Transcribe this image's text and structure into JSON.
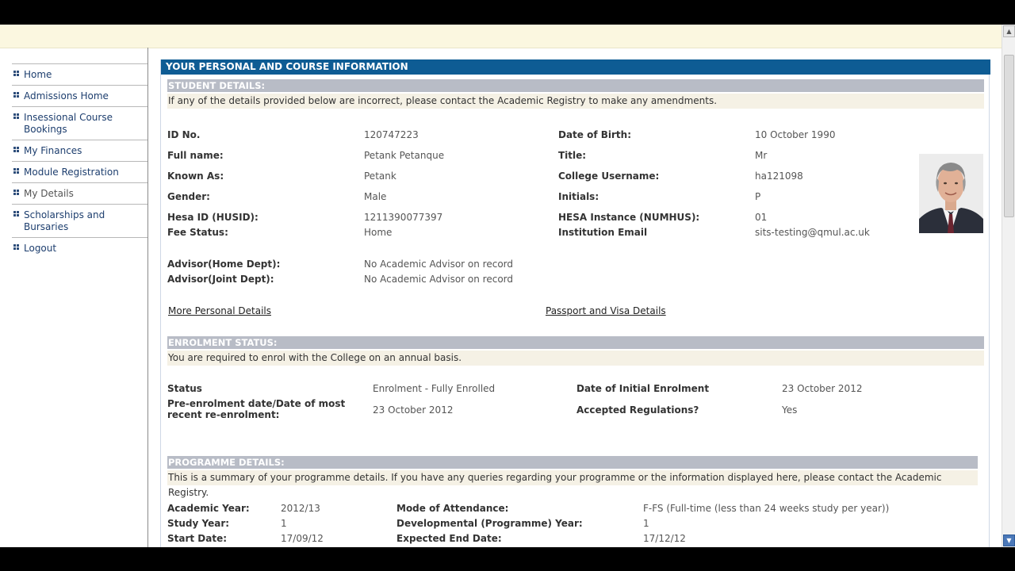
{
  "sidebar": {
    "items": [
      {
        "label": "Home"
      },
      {
        "label": "Admissions Home"
      },
      {
        "label": "Insessional Course Bookings"
      },
      {
        "label": "My Finances"
      },
      {
        "label": "Module Registration"
      },
      {
        "label": "My Details"
      },
      {
        "label": "Scholarships and Bursaries"
      },
      {
        "label": "Logout"
      }
    ]
  },
  "main": {
    "title": "YOUR PERSONAL AND COURSE INFORMATION"
  },
  "student": {
    "heading": "STUDENT DETAILS:",
    "note": "If any of the details provided below are incorrect, please contact the Academic Registry to make any amendments.",
    "left": [
      {
        "label": "ID No.",
        "value": "120747223"
      },
      {
        "label": "Full name:",
        "value": "Petank Petanque"
      },
      {
        "label": "Known As:",
        "value": "Petank"
      },
      {
        "label": "Gender:",
        "value": "Male"
      },
      {
        "label": "Hesa ID (HUSID):",
        "value": "1211390077397"
      },
      {
        "label": "Fee Status:",
        "value": "Home"
      },
      {
        "label": "Advisor(Home Dept):",
        "value": "No Academic Advisor on record"
      },
      {
        "label": "Advisor(Joint Dept):",
        "value": "No Academic Advisor on record"
      }
    ],
    "right": [
      {
        "label": "Date of Birth:",
        "value": "10 October 1990"
      },
      {
        "label": "Title:",
        "value": "Mr"
      },
      {
        "label": "College Username:",
        "value": "ha121098"
      },
      {
        "label": "Initials:",
        "value": "P"
      },
      {
        "label": "HESA Instance (NUMHUS):",
        "value": "01"
      },
      {
        "label": "Institution Email",
        "value": "sits-testing@qmul.ac.uk"
      }
    ],
    "links": {
      "more_personal": "More Personal Details",
      "passport_visa": "Passport and Visa Details"
    }
  },
  "enrolment": {
    "heading": "ENROLMENT STATUS:",
    "note": "You are required to enrol with the College on an annual basis.",
    "status_label": "Status",
    "status_value": "Enrolment - Fully Enrolled",
    "initial_label": "Date of Initial Enrolment",
    "initial_value": "23 October 2012",
    "pre_label": "Pre-enrolment date/Date of most recent re-enrolment:",
    "pre_value": "23 October 2012",
    "regs_label": "Accepted Regulations?",
    "regs_value": "Yes"
  },
  "programme": {
    "heading": "PROGRAMME DETAILS:",
    "note": "This is a summary of your programme details. If you have any queries regarding your programme or the information displayed here, please contact the Academic Registry.",
    "rows": [
      {
        "label": "Academic Year:",
        "value": "2012/13",
        "label2": "Mode of Attendance:",
        "value2": "F-FS (Full-time (less than 24 weeks study per year))"
      },
      {
        "label": "Study Year:",
        "value": "1",
        "label2": "Developmental (Programme) Year:",
        "value2": "1"
      },
      {
        "label": "Start Date:",
        "value": "17/09/12",
        "label2": "Expected End Date:",
        "value2": "17/12/12"
      }
    ]
  },
  "icons": {
    "nav_bullet": "grid-bullet-icon",
    "scroll_up": "arrow-up-icon",
    "scroll_down": "arrow-down-icon",
    "photo": "student-photo"
  },
  "colors": {
    "header_blue": "#0e5c94",
    "section_grey": "#b8bcc6",
    "note_beige": "#f5f1e5",
    "top_band": "#fbf7e0"
  }
}
